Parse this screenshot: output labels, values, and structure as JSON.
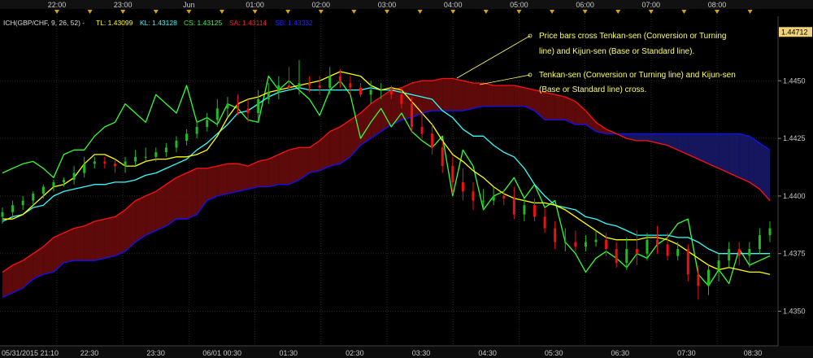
{
  "colors": {
    "background": "#000000",
    "grid": "#2a2a2a",
    "tenkan": "#ffff00",
    "kijun": "#33ffff",
    "chikou": "#33ff33",
    "senkou_a": "#ff1111",
    "senkou_b": "#1010ff",
    "cloud_bull": "#6e0c0c",
    "cloud_bear": "#1a1a6e",
    "candle_up": "#22bb22",
    "candle_down": "#ee1111",
    "session_marker": "#d4a21a",
    "price_box": "#f0d27a"
  },
  "legend": {
    "name": "ICH(GBP/CHF, 9, 26, 52) -",
    "tl": "TL: 1.43099",
    "kl": "KL: 1.43128",
    "cs": "CS: 1.43125",
    "sa": "SA: 1.43114",
    "sb": "SB: 1.43332"
  },
  "top_axis": [
    "22:00",
    "23:00",
    "Jun",
    "01:00",
    "02:00",
    "03:00",
    "04:00",
    "05:00",
    "06:00",
    "07:00",
    "08:00"
  ],
  "bottom_axis": [
    "05/31/2015 21:10",
    "22:30",
    "23:30",
    "06/01 00:30",
    "01:30",
    "02:30",
    "03:30",
    "04:30",
    "05:30",
    "06:30",
    "07:30",
    "08:30"
  ],
  "annotations": [
    {
      "lines": [
        "Price bars cross Tenkan-sen (Conversion or Turning",
        "line) and Kijun-sen (Base or Standard line)."
      ]
    },
    {
      "lines": [
        "Tenkan-sen (Conversion or Turning line) and Kijun-sen",
        "(Base or Standard line) cross."
      ]
    }
  ],
  "chart_data": {
    "type": "line",
    "title": "",
    "xlabel": "",
    "ylabel": "",
    "ylim": [
      1.4335,
      1.4478
    ],
    "y_ticks": [
      "1.4350",
      "1.4375",
      "1.4400",
      "1.4425",
      "1.4450"
    ],
    "last_price": "1.44712",
    "x": [
      0,
      2,
      4,
      6,
      8,
      10,
      12,
      14,
      16,
      18,
      20,
      22,
      24,
      26,
      28,
      30,
      32,
      34,
      36,
      38,
      40,
      42,
      44,
      46,
      48,
      50,
      52,
      54,
      56,
      58,
      60,
      62,
      64,
      66,
      68,
      70,
      72,
      74,
      76,
      78,
      80,
      82,
      84,
      86,
      88,
      90,
      92,
      94,
      96,
      98,
      100,
      102,
      104,
      106,
      108,
      110,
      112,
      114,
      116,
      118,
      120,
      122,
      124,
      126,
      128,
      130,
      132,
      134,
      136,
      138,
      140,
      142,
      144,
      146,
      148,
      150
    ],
    "series": [
      {
        "key": "tenkan",
        "values": [
          1.439,
          1.439,
          1.4392,
          1.4396,
          1.44,
          1.4404,
          1.4405,
          1.4408,
          1.4414,
          1.4418,
          1.4418,
          1.4416,
          1.4413,
          1.4413,
          1.4415,
          1.4416,
          1.4416,
          1.4417,
          1.4417,
          1.4418,
          1.442,
          1.4426,
          1.4434,
          1.444,
          1.4442,
          1.4443,
          1.4445,
          1.4446,
          1.4447,
          1.4448,
          1.4449,
          1.445,
          1.4452,
          1.4454,
          1.4453,
          1.4452,
          1.4448,
          1.4446,
          1.4447,
          1.4446,
          1.4441,
          1.4436,
          1.4431,
          1.4424,
          1.4418,
          1.4415,
          1.4411,
          1.4408,
          1.4404,
          1.4401,
          1.4399,
          1.4398,
          1.4397,
          1.4397,
          1.4396,
          1.4394,
          1.4391,
          1.4388,
          1.4385,
          1.4382,
          1.4381,
          1.4381,
          1.4381,
          1.4382,
          1.4382,
          1.4381,
          1.4379,
          1.4376,
          1.4373,
          1.437,
          1.4368,
          1.4369,
          1.4368,
          1.4367,
          1.4367,
          1.4366
        ]
      },
      {
        "key": "kijun",
        "values": [
          1.4389,
          1.4391,
          1.4392,
          1.4395,
          1.4396,
          1.44,
          1.4402,
          1.4403,
          1.4404,
          1.4405,
          1.4405,
          1.4406,
          1.4406,
          1.4407,
          1.4409,
          1.441,
          1.4412,
          1.4414,
          1.4416,
          1.442,
          1.4423,
          1.4427,
          1.4431,
          1.4436,
          1.4437,
          1.444,
          1.4443,
          1.4445,
          1.4446,
          1.4447,
          1.4446,
          1.4446,
          1.4446,
          1.4446,
          1.4446,
          1.4446,
          1.4447,
          1.4446,
          1.4446,
          1.4445,
          1.4444,
          1.4443,
          1.4442,
          1.4437,
          1.4434,
          1.4429,
          1.4426,
          1.4426,
          1.4422,
          1.4419,
          1.4417,
          1.4412,
          1.4405,
          1.44,
          1.4396,
          1.4395,
          1.4394,
          1.4391,
          1.439,
          1.4388,
          1.4387,
          1.4385,
          1.4383,
          1.4383,
          1.4383,
          1.4383,
          1.4382,
          1.4382,
          1.438,
          1.4377,
          1.4375,
          1.4375,
          1.4375,
          1.4375,
          1.4375,
          1.4375
        ]
      },
      {
        "key": "chikou",
        "values": [
          1.441,
          1.4412,
          1.4414,
          1.4415,
          1.4412,
          1.4408,
          1.4418,
          1.442,
          1.442,
          1.4426,
          1.443,
          1.4432,
          1.444,
          1.4436,
          1.4432,
          1.4444,
          1.444,
          1.4436,
          1.4448,
          1.4432,
          1.4434,
          1.4431,
          1.444,
          1.4438,
          1.4433,
          1.4432,
          1.4452,
          1.4446,
          1.445,
          1.4446,
          1.4442,
          1.4435,
          1.4446,
          1.445,
          1.4444,
          1.4425,
          1.4432,
          1.4438,
          1.443,
          1.4436,
          1.4428,
          1.4424,
          1.4421,
          1.4426,
          1.44,
          1.442,
          1.4413,
          1.4394,
          1.44,
          1.4402,
          1.4408,
          1.4399,
          1.4405,
          1.4395,
          1.4398,
          1.438,
          1.4375,
          1.4367,
          1.4373,
          1.4376,
          1.4373,
          1.4369,
          1.4375,
          1.4373,
          1.4379,
          1.4382,
          1.4388,
          1.439,
          1.4366,
          1.4361,
          1.4368,
          1.4362,
          1.4377,
          1.437,
          1.4372,
          1.4374
        ]
      },
      {
        "key": "senkou_a",
        "values": [
          1.4367,
          1.437,
          1.4372,
          1.4375,
          1.4378,
          1.4382,
          1.4384,
          1.4386,
          1.4387,
          1.4389,
          1.439,
          1.4391,
          1.4394,
          1.4398,
          1.44,
          1.4402,
          1.4405,
          1.4408,
          1.441,
          1.4412,
          1.4412,
          1.4413,
          1.4414,
          1.4414,
          1.4413,
          1.4415,
          1.4416,
          1.4418,
          1.442,
          1.4421,
          1.4421,
          1.4424,
          1.4428,
          1.443,
          1.4433,
          1.4436,
          1.444,
          1.4443,
          1.4446,
          1.4447,
          1.4449,
          1.445,
          1.445,
          1.4451,
          1.4451,
          1.445,
          1.4449,
          1.4449,
          1.4448,
          1.4448,
          1.4448,
          1.4447,
          1.4446,
          1.4445,
          1.4444,
          1.4443,
          1.4441,
          1.4437,
          1.4432,
          1.4429,
          1.4427,
          1.4425,
          1.4424,
          1.4424,
          1.4423,
          1.4422,
          1.442,
          1.4418,
          1.4416,
          1.4414,
          1.4412,
          1.441,
          1.4408,
          1.4406,
          1.4403,
          1.4398
        ]
      },
      {
        "key": "senkou_b",
        "values": [
          1.4356,
          1.4358,
          1.436,
          1.4364,
          1.4366,
          1.4367,
          1.4371,
          1.4372,
          1.4372,
          1.4372,
          1.4373,
          1.4374,
          1.4376,
          1.438,
          1.4383,
          1.4385,
          1.4387,
          1.439,
          1.439,
          1.4392,
          1.4398,
          1.44,
          1.4401,
          1.4402,
          1.4403,
          1.4404,
          1.4404,
          1.4405,
          1.4405,
          1.4407,
          1.441,
          1.4411,
          1.4413,
          1.4414,
          1.4417,
          1.4422,
          1.4425,
          1.4428,
          1.4431,
          1.4433,
          1.4434,
          1.4436,
          1.4437,
          1.4437,
          1.4437,
          1.4437,
          1.4438,
          1.4439,
          1.4439,
          1.4439,
          1.4439,
          1.4439,
          1.4437,
          1.4433,
          1.4433,
          1.4433,
          1.4431,
          1.4431,
          1.4428,
          1.4427,
          1.4427,
          1.4427,
          1.4427,
          1.4427,
          1.4427,
          1.4427,
          1.4427,
          1.4427,
          1.4427,
          1.4427,
          1.4427,
          1.4427,
          1.4427,
          1.4426,
          1.4423,
          1.442
        ]
      }
    ],
    "candles": {
      "x": [
        0,
        2,
        4,
        6,
        8,
        10,
        12,
        14,
        16,
        18,
        20,
        22,
        24,
        26,
        28,
        30,
        32,
        34,
        36,
        38,
        40,
        42,
        44,
        46,
        48,
        50,
        52,
        54,
        56,
        58,
        60,
        62,
        64,
        66,
        68,
        70,
        72,
        74,
        76,
        78,
        80,
        82,
        84,
        86,
        88,
        90,
        92,
        94,
        96,
        98,
        100,
        102,
        104,
        106,
        108,
        110,
        112,
        114,
        116,
        118,
        120,
        122,
        124,
        126,
        128,
        130,
        132,
        134,
        136,
        138,
        140,
        142,
        144,
        146,
        148,
        150
      ],
      "open": [
        1.4391,
        1.4393,
        1.4396,
        1.4398,
        1.4401,
        1.4404,
        1.4406,
        1.4407,
        1.441,
        1.4414,
        1.4415,
        1.4414,
        1.4413,
        1.4415,
        1.4417,
        1.4417,
        1.4419,
        1.4421,
        1.4424,
        1.4427,
        1.443,
        1.4433,
        1.4438,
        1.444,
        1.4438,
        1.4436,
        1.4442,
        1.4445,
        1.4448,
        1.4447,
        1.4449,
        1.4448,
        1.4447,
        1.4452,
        1.4449,
        1.4447,
        1.4444,
        1.4446,
        1.4446,
        1.4444,
        1.444,
        1.443,
        1.4427,
        1.4421,
        1.4413,
        1.4406,
        1.4402,
        1.4398,
        1.4398,
        1.44,
        1.4399,
        1.4392,
        1.4396,
        1.4391,
        1.4386,
        1.438,
        1.438,
        1.4378,
        1.438,
        1.4381,
        1.4377,
        1.4371,
        1.4377,
        1.4375,
        1.4381,
        1.4379,
        1.4374,
        1.4377,
        1.4366,
        1.4361,
        1.4368,
        1.4372,
        1.4377,
        1.4374,
        1.4377,
        1.4383
      ],
      "high": [
        1.4395,
        1.4398,
        1.44,
        1.4402,
        1.4405,
        1.4407,
        1.4408,
        1.4413,
        1.4417,
        1.4417,
        1.4417,
        1.4416,
        1.4417,
        1.442,
        1.4421,
        1.4421,
        1.4423,
        1.4426,
        1.4429,
        1.4433,
        1.4436,
        1.4442,
        1.4443,
        1.4444,
        1.4442,
        1.4446,
        1.4449,
        1.4452,
        1.4456,
        1.4459,
        1.4452,
        1.4452,
        1.4456,
        1.4455,
        1.4452,
        1.4449,
        1.445,
        1.4449,
        1.4448,
        1.4447,
        1.4443,
        1.4436,
        1.4431,
        1.4424,
        1.4417,
        1.4412,
        1.4406,
        1.4403,
        1.4404,
        1.4403,
        1.4404,
        1.4399,
        1.4399,
        1.4395,
        1.4389,
        1.4386,
        1.4385,
        1.4383,
        1.4385,
        1.4384,
        1.438,
        1.4382,
        1.4385,
        1.4384,
        1.4387,
        1.4384,
        1.438,
        1.4379,
        1.437,
        1.437,
        1.4375,
        1.438,
        1.438,
        1.438,
        1.4386,
        1.4389
      ],
      "low": [
        1.4388,
        1.439,
        1.4394,
        1.4396,
        1.4399,
        1.4402,
        1.4404,
        1.4405,
        1.4408,
        1.4412,
        1.4412,
        1.441,
        1.441,
        1.4413,
        1.4415,
        1.4415,
        1.4417,
        1.4419,
        1.4422,
        1.4425,
        1.4428,
        1.443,
        1.4434,
        1.4435,
        1.4432,
        1.4433,
        1.444,
        1.4442,
        1.4446,
        1.4444,
        1.4445,
        1.4444,
        1.4444,
        1.4447,
        1.4444,
        1.4443,
        1.444,
        1.4442,
        1.4442,
        1.4438,
        1.4428,
        1.4425,
        1.4418,
        1.441,
        1.4401,
        1.4398,
        1.4394,
        1.4394,
        1.4396,
        1.4396,
        1.439,
        1.4389,
        1.4389,
        1.4384,
        1.4377,
        1.4376,
        1.4376,
        1.4376,
        1.4378,
        1.4374,
        1.4369,
        1.4368,
        1.437,
        1.4372,
        1.4375,
        1.4372,
        1.4372,
        1.4363,
        1.4355,
        1.4357,
        1.4363,
        1.4369,
        1.437,
        1.4369,
        1.4375,
        1.438
      ],
      "close": [
        1.4393,
        1.4396,
        1.4398,
        1.4401,
        1.4404,
        1.4406,
        1.4407,
        1.441,
        1.4414,
        1.4415,
        1.4414,
        1.4413,
        1.4415,
        1.4417,
        1.4417,
        1.4419,
        1.4421,
        1.4424,
        1.4427,
        1.443,
        1.4433,
        1.4438,
        1.444,
        1.4438,
        1.4436,
        1.4442,
        1.4445,
        1.4448,
        1.4447,
        1.4449,
        1.4448,
        1.4447,
        1.4452,
        1.4449,
        1.4447,
        1.4444,
        1.4446,
        1.4446,
        1.4444,
        1.444,
        1.443,
        1.4427,
        1.4421,
        1.4413,
        1.4406,
        1.4402,
        1.4398,
        1.4398,
        1.44,
        1.4399,
        1.4392,
        1.4396,
        1.4391,
        1.4386,
        1.438,
        1.438,
        1.4378,
        1.438,
        1.4381,
        1.4377,
        1.4371,
        1.4377,
        1.4375,
        1.4381,
        1.4379,
        1.4374,
        1.4377,
        1.4366,
        1.4361,
        1.4368,
        1.4372,
        1.4377,
        1.4374,
        1.4377,
        1.4383,
        1.4386
      ]
    }
  }
}
